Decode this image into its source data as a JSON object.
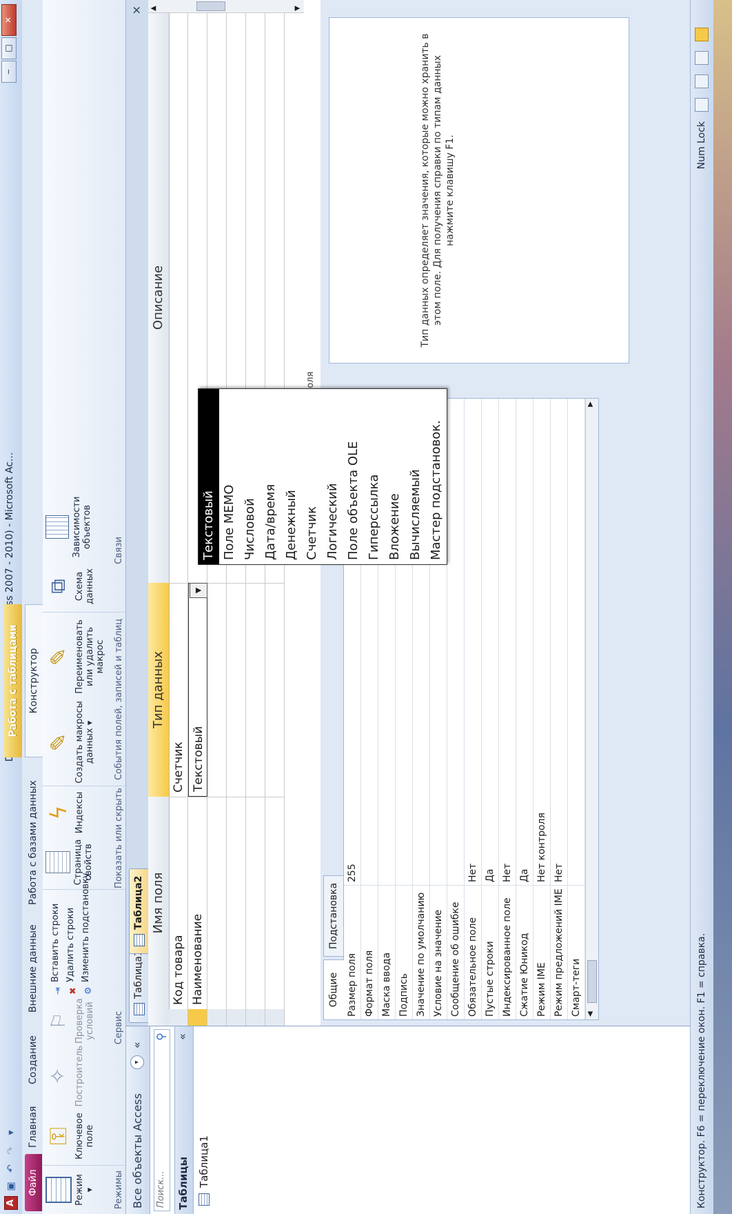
{
  "titlebar": {
    "app_icon": "A",
    "title": "Database1 : база данных (Access 2007 - 2010)  -  Microsoft Ac...",
    "qat_icons": [
      "save-icon",
      "undo-icon",
      "redo-icon",
      "customize-icon"
    ],
    "sys": {
      "min": "‒",
      "max": "□",
      "close": "✕"
    }
  },
  "tabs": {
    "file": "Файл",
    "home": "Главная",
    "create": "Создание",
    "external": "Внешние данные",
    "database": "Работа с базами данных",
    "context_header": "Работа с таблицами",
    "designer": "Конструктор"
  },
  "ribbon": {
    "groups": {
      "views": {
        "label": "Режимы",
        "view_btn": "Режим\n▾"
      },
      "tools": {
        "label": "Сервис",
        "key": "Ключевое\nполе",
        "builder": "Построитель",
        "check": "Проверка\nусловий",
        "insert_rows": "Вставить строки",
        "delete_rows": "Удалить строки",
        "modify_lookup": "Изменить подстановку"
      },
      "show_hide": {
        "label": "Показать или скрыть",
        "props": "Страница\nсвойств",
        "indexes": "Индексы"
      },
      "events": {
        "label": "События полей, записей и таблиц",
        "create_macros": "Создать макросы\nданных ▾",
        "rename_macro": "Переименовать\nили удалить макрос"
      },
      "relations": {
        "label": "Связи",
        "schema": "Схема\nданных",
        "deps": "Зависимости\nобъектов"
      }
    }
  },
  "nav": {
    "header": "Все объекты Access",
    "search_placeholder": "Поиск...",
    "group_title": "Таблицы",
    "items": [
      "Таблица1"
    ]
  },
  "doc": {
    "tabs": [
      "Таблица1",
      "Таблица2"
    ],
    "grid": {
      "headers": {
        "name": "Имя поля",
        "type": "Тип данных",
        "desc": "Описание"
      },
      "rows": [
        {
          "name": "Код товара",
          "type": "Счетчик",
          "desc": ""
        },
        {
          "name": "Наименование",
          "type": "Текстовый",
          "desc": ""
        }
      ]
    },
    "props_caption": "Свойства поля",
    "props_caption_visible": "ва поля",
    "prop_tabs": [
      "Общие",
      "Подстановка"
    ],
    "props": [
      {
        "name": "Размер поля",
        "value": "255"
      },
      {
        "name": "Формат поля",
        "value": ""
      },
      {
        "name": "Маска ввода",
        "value": ""
      },
      {
        "name": "Подпись",
        "value": ""
      },
      {
        "name": "Значение по умолчанию",
        "value": ""
      },
      {
        "name": "Условие на значение",
        "value": ""
      },
      {
        "name": "Сообщение об ошибке",
        "value": ""
      },
      {
        "name": "Обязательное поле",
        "value": "Нет"
      },
      {
        "name": "Пустые строки",
        "value": "Да"
      },
      {
        "name": "Индексированное поле",
        "value": "Нет"
      },
      {
        "name": "Сжатие Юникод",
        "value": "Да"
      },
      {
        "name": "Режим IME",
        "value": "Нет контроля"
      },
      {
        "name": "Режим предложений IME",
        "value": "Нет"
      },
      {
        "name": "Смарт-теги",
        "value": ""
      }
    ],
    "hint": "Тип данных определяет значения, которые можно хранить в этом поле. Для получения справки по типам данных нажмите клавишу F1.",
    "dropdown": [
      "Текстовый",
      "Поле МЕМО",
      "Числовой",
      "Дата/время",
      "Денежный",
      "Счетчик",
      "Логический",
      "Поле объекта OLE",
      "Гиперссылка",
      "Вложение",
      "Вычисляемый",
      "Мастер подстановок."
    ],
    "dropdown_selected": "Текстовый"
  },
  "status": {
    "text": "Конструктор.  F6 = переключение окон.  F1 = справка.",
    "numlock": "Num Lock"
  },
  "colors": {
    "file_tab": "#b02a6f",
    "context_tab": "#f0c94d",
    "selected_item": "#000000"
  }
}
